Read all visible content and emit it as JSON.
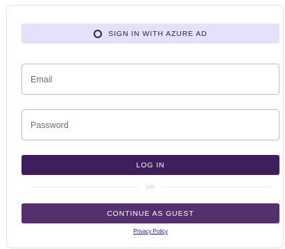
{
  "azure": {
    "label": "SIGN IN WITH AZURE AD",
    "icon": "circle-icon"
  },
  "email": {
    "placeholder": "Email",
    "value": ""
  },
  "password": {
    "placeholder": "Password",
    "value": ""
  },
  "login": {
    "label": "LOG IN"
  },
  "divider": {
    "label": "OR"
  },
  "guest": {
    "label": "CONTINUE AS GUEST"
  },
  "privacy": {
    "label": "Privacy Policy"
  },
  "colors": {
    "azure_bg": "#e6e0fb",
    "login_bg": "#3d1f5c",
    "guest_bg": "#55306f",
    "link": "#1a1a8c"
  }
}
